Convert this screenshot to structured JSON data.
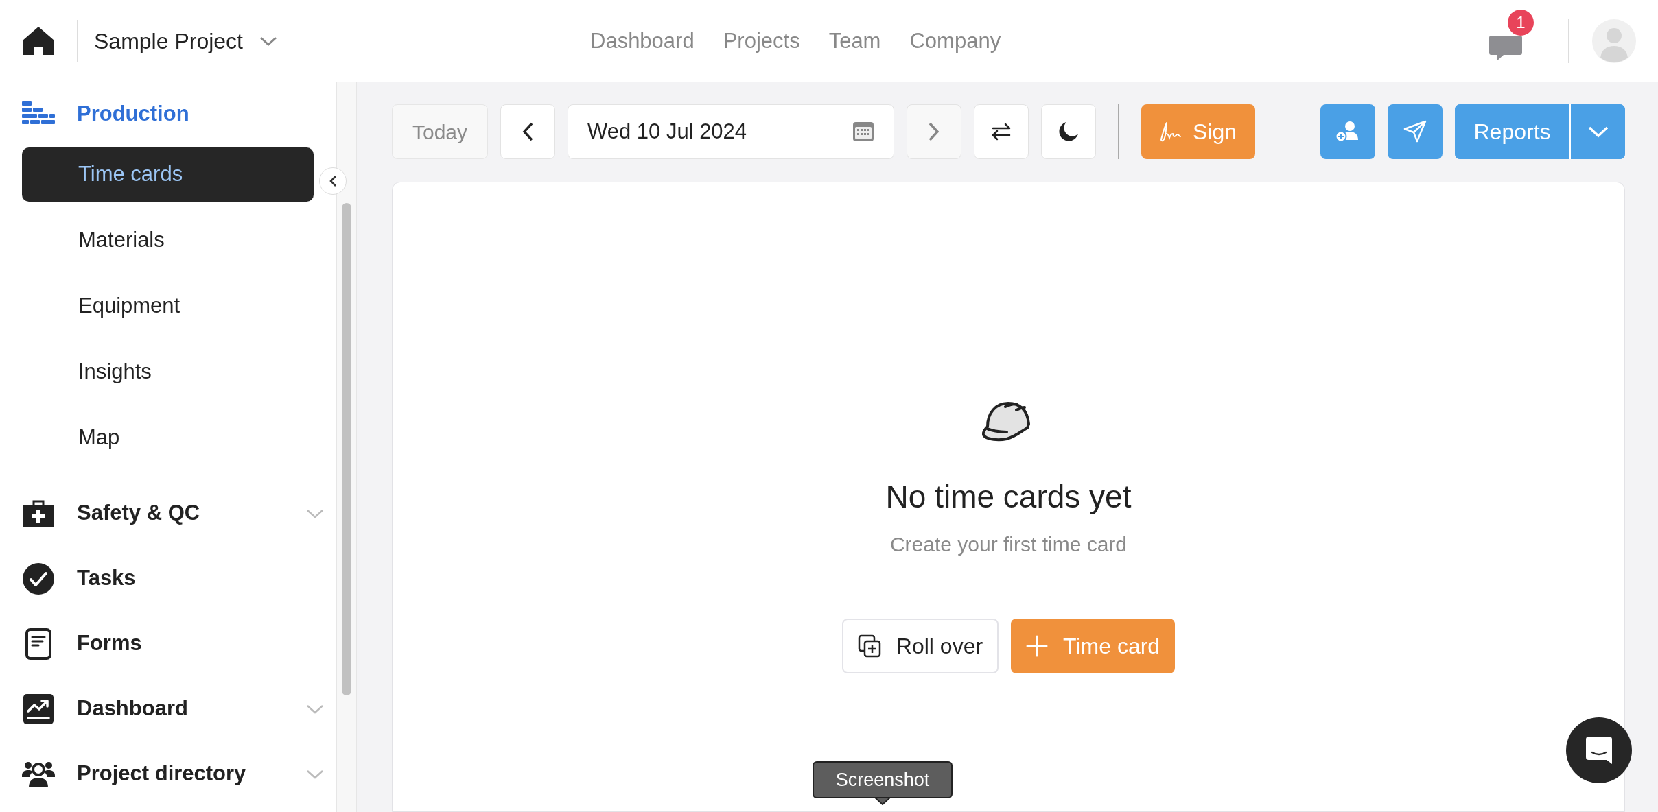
{
  "header": {
    "project": "Sample Project",
    "nav": [
      {
        "label": "Dashboard"
      },
      {
        "label": "Projects"
      },
      {
        "label": "Team"
      },
      {
        "label": "Company"
      }
    ],
    "notifications": "1"
  },
  "sidebar": {
    "items": [
      {
        "label": "Production",
        "selected": true,
        "children": [
          {
            "label": "Time cards",
            "selected": true
          },
          {
            "label": "Materials",
            "selected": false
          },
          {
            "label": "Equipment",
            "selected": false
          },
          {
            "label": "Insights",
            "selected": false
          },
          {
            "label": "Map",
            "selected": false
          }
        ]
      },
      {
        "label": "Safety & QC",
        "selected": false,
        "expanded": false
      },
      {
        "label": "Tasks",
        "selected": false
      },
      {
        "label": "Forms",
        "selected": false
      },
      {
        "label": "Dashboard",
        "selected": false,
        "expanded": false
      },
      {
        "label": "Project directory",
        "selected": false,
        "expanded": false
      }
    ]
  },
  "toolbar": {
    "today": {
      "label": "Today",
      "disabled": true
    },
    "previous": {
      "disabled": false
    },
    "date": "Wed 10 Jul 2024",
    "next": {
      "disabled": true
    },
    "sign": "Sign",
    "reports": "Reports"
  },
  "empty_state": {
    "title": "No time cards yet",
    "subtitle": "Create your first time card",
    "buttons": [
      {
        "label": "Roll over",
        "kind": "secondary"
      },
      {
        "label": "Time card",
        "kind": "primary"
      }
    ]
  },
  "tooltip": "Screenshot"
}
